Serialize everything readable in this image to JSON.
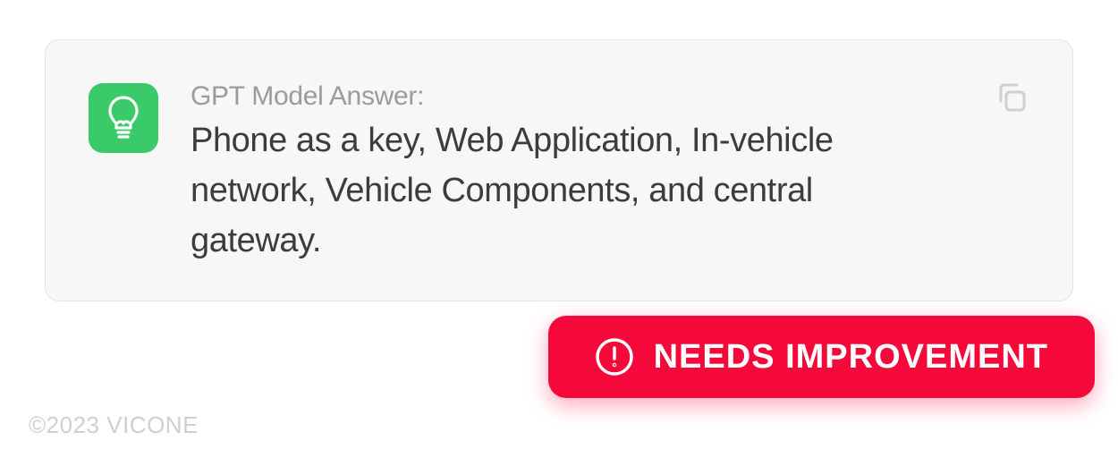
{
  "answer": {
    "label": "GPT Model Answer:",
    "body": "Phone as a key, Web Application, In-vehicle network, Vehicle Components, and central gateway."
  },
  "status": {
    "text": "NEEDS IMPROVEMENT"
  },
  "footer": {
    "copyright": "©2023 VICONE"
  }
}
